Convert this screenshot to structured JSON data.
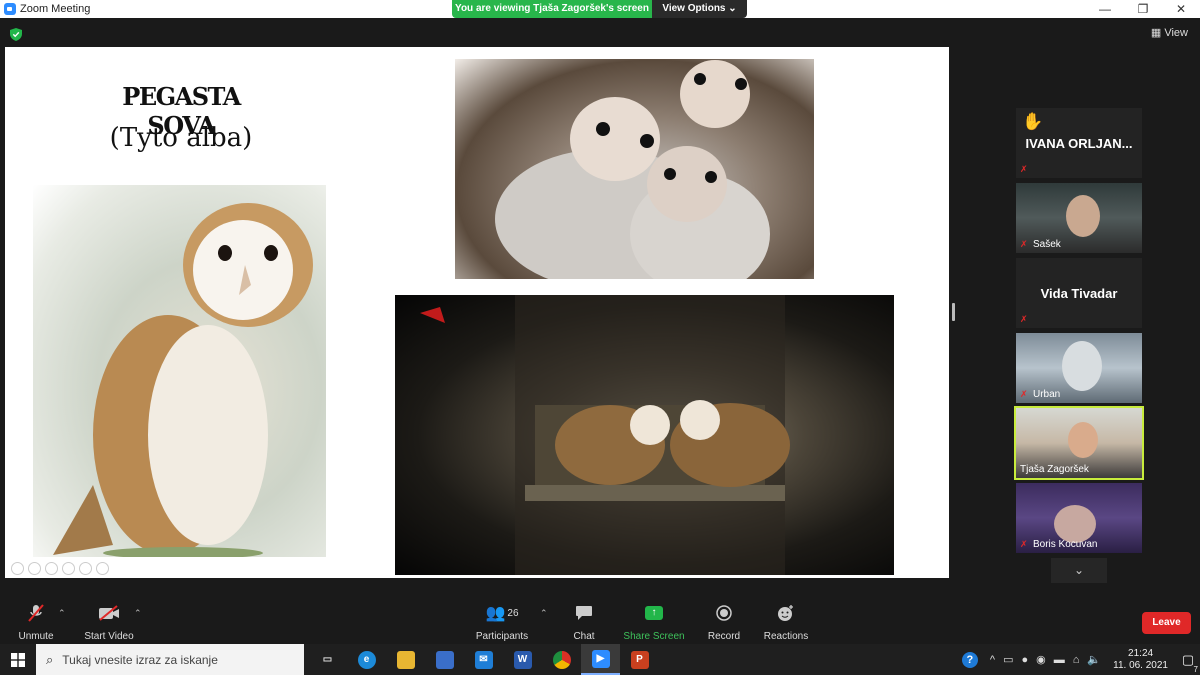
{
  "window": {
    "title": "Zoom Meeting",
    "controls": [
      "—",
      "❐",
      "✕"
    ]
  },
  "banner": {
    "viewing": "You are viewing Tjaša Zagoršek's screen",
    "view_options": "View Options ⌄"
  },
  "top_right": {
    "view_label": "View"
  },
  "slide": {
    "title": "PEGASTA SOVA",
    "subtitle": "(Tyto alba)"
  },
  "participants": [
    {
      "name": "IVANA  ORLJAN...",
      "raised_hand": true,
      "muted": true,
      "video": false
    },
    {
      "name": "Sašek",
      "muted": true,
      "video": true
    },
    {
      "name": "Vida Tivadar",
      "muted": true,
      "video": false
    },
    {
      "name": "Urban",
      "muted": true,
      "video": true
    },
    {
      "name": "Tjaša Zagoršek",
      "muted": false,
      "video": true,
      "active_speaker": true
    },
    {
      "name": "Boris Kocuvan",
      "muted": true,
      "video": true
    }
  ],
  "toolbar": {
    "unmute": "Unmute",
    "start_video": "Start Video",
    "participants": "Participants",
    "participants_count": "26",
    "chat": "Chat",
    "share_screen": "Share Screen",
    "record": "Record",
    "reactions": "Reactions",
    "leave": "Leave"
  },
  "taskbar": {
    "search_placeholder": "Tukaj vnesite izraz za iskanje",
    "apps": [
      "task-view",
      "edge",
      "file-explorer",
      "store",
      "mail",
      "word",
      "chrome",
      "zoom",
      "powerpoint"
    ],
    "time": "21:24",
    "date": "11. 06. 2021",
    "notification_count": "7"
  },
  "colors": {
    "banner_green": "#28b64b",
    "leave_red": "#e02828",
    "active_speaker_border": "#c8ec3c",
    "share_green": "#22b64a"
  }
}
